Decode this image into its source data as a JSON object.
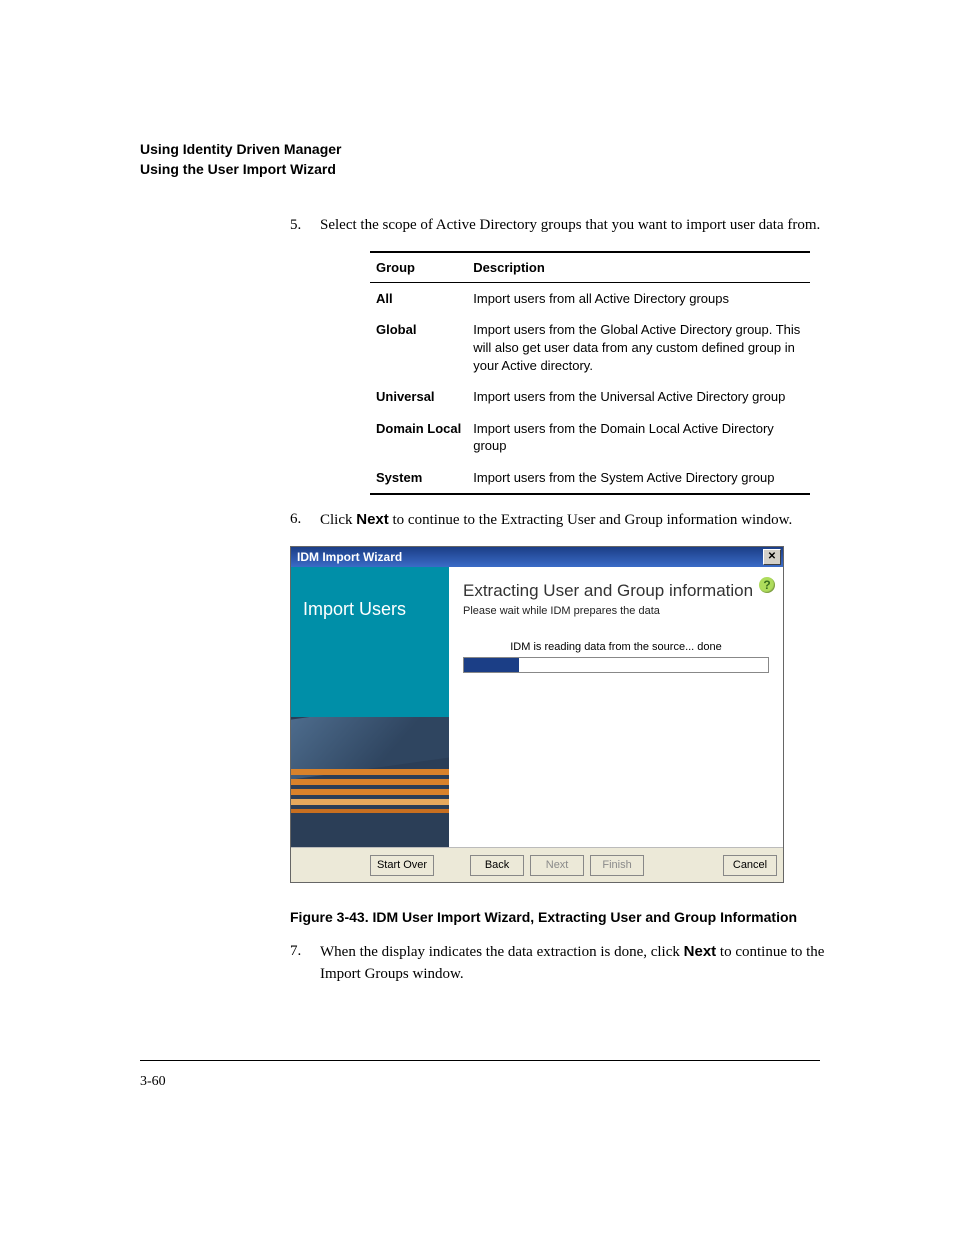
{
  "header": {
    "line1": "Using Identity Driven Manager",
    "line2": "Using the User Import Wizard"
  },
  "steps": {
    "s5": {
      "num": "5.",
      "text": "Select the scope of Active Directory groups that you want to import user data from."
    },
    "s6": {
      "num": "6.",
      "prefix": "Click ",
      "bold": "Next",
      "suffix": " to continue to the Extracting User and Group information window."
    },
    "s7": {
      "num": "7.",
      "prefix": "When the display indicates the data extraction is done, click ",
      "bold": "Next",
      "suffix": " to continue to the Import Groups window."
    }
  },
  "table": {
    "head_group": "Group",
    "head_desc": "Description",
    "rows": [
      {
        "g": "All",
        "d": "Import users from all Active Directory groups"
      },
      {
        "g": "Global",
        "d": "Import users from the Global Active Directory group. This will also get user data from any custom defined group in your Active directory."
      },
      {
        "g": "Universal",
        "d": "Import users from the Universal Active Directory group"
      },
      {
        "g": "Domain Local",
        "d": "Import users from the Domain Local Active Directory group"
      },
      {
        "g": "System",
        "d": "Import users from the System Active Directory group"
      }
    ]
  },
  "wizard": {
    "title": "IDM Import Wizard",
    "side_title": "Import Users",
    "heading": "Extracting User and Group information",
    "sub": "Please wait while IDM prepares the data",
    "progress_label": "IDM is reading data from the source... done",
    "progress_percent": 18,
    "buttons": {
      "start_over": "Start Over",
      "back": "Back",
      "next": "Next",
      "finish": "Finish",
      "cancel": "Cancel"
    }
  },
  "figure_caption": "Figure 3-43. IDM User Import Wizard, Extracting User and Group Information",
  "page_number": "3-60"
}
